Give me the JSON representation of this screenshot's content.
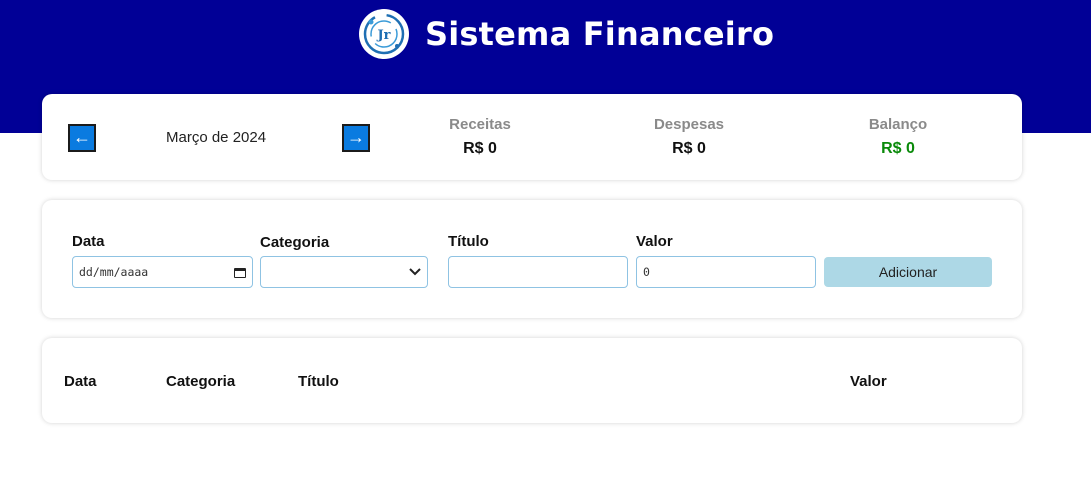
{
  "header": {
    "title": "Sistema Financeiro",
    "logo_text": "Jr"
  },
  "summary": {
    "prev_symbol": "←",
    "next_symbol": "→",
    "month": "Março de 2024",
    "receitas_label": "Receitas",
    "receitas_value": "R$ 0",
    "despesas_label": "Despesas",
    "despesas_value": "R$ 0",
    "balanco_label": "Balanço",
    "balanco_value": "R$ 0"
  },
  "form": {
    "date_label": "Data",
    "date_value": "dd/mm/aaaa",
    "category_label": "Categoria",
    "category_value": "",
    "title_label": "Título",
    "title_value": "",
    "value_label": "Valor",
    "value_value": "0",
    "add_button": "Adicionar"
  },
  "table": {
    "columns": [
      "Data",
      "Categoria",
      "Título",
      "Valor"
    ]
  },
  "colors": {
    "header_bg": "#010096",
    "nav_button": "#0a7be0",
    "add_button": "#add8e6",
    "balance_value": "#0a8a0a"
  },
  "icons": [
    "logo-icon",
    "arrow-left-icon",
    "arrow-right-icon",
    "calendar-icon",
    "chevron-down-icon"
  ]
}
